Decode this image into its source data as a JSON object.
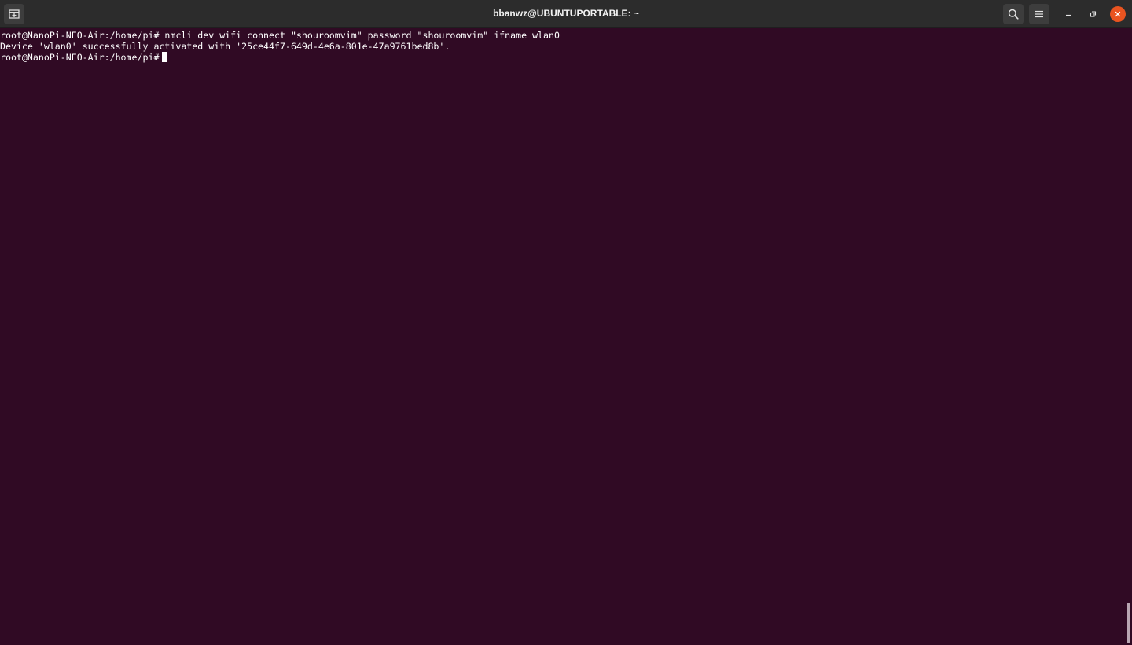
{
  "window": {
    "title": "bbanwz@UBUNTUPORTABLE: ~"
  },
  "toolbar": {
    "new_tab_icon": "new-tab-icon",
    "search_icon": "search-icon",
    "menu_icon": "hamburger-menu-icon",
    "minimize_icon": "minimize-icon",
    "maximize_icon": "maximize-icon",
    "close_icon": "close-icon"
  },
  "terminal": {
    "lines": [
      "root@NanoPi-NEO-Air:/home/pi# nmcli dev wifi connect \"shouroomvim\" password \"shouroomvim\" ifname wlan0",
      "Device 'wlan0' successfully activated with '25ce44f7-649d-4e6a-801e-47a9761bed8b'."
    ],
    "prompt": "root@NanoPi-NEO-Air:/home/pi#"
  },
  "colors": {
    "terminal_bg": "#300a24",
    "titlebar_bg": "#2c2c2c",
    "text": "#ffffff",
    "close_button": "#e95420"
  }
}
